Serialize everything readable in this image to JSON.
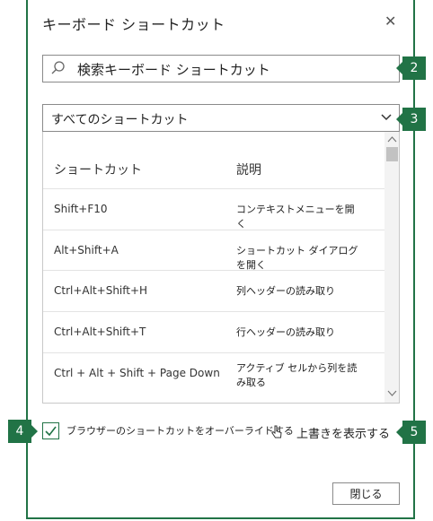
{
  "dialog": {
    "title": "キーボード ショートカット",
    "close_glyph": "✕"
  },
  "search": {
    "placeholder": "検索キーボード ショートカット"
  },
  "filter": {
    "selected": "すべてのショートカット"
  },
  "table": {
    "headers": {
      "shortcut": "ショートカット",
      "description": "説明"
    },
    "rows": [
      {
        "keys": "Shift+F10",
        "description": "コンテキストメニューを開く"
      },
      {
        "keys": "Alt+Shift+A",
        "description": "ショートカット ダイアログを開く"
      },
      {
        "keys": "Ctrl+Alt+Shift+H",
        "description": "列ヘッダーの読み取り"
      },
      {
        "keys": "Ctrl+Alt+Shift+T",
        "description": "行ヘッダーの読み取り"
      },
      {
        "keys": "Ctrl + Alt + Shift + Page Down",
        "description": "アクティブ セルから列を読み取る"
      }
    ]
  },
  "override": {
    "label": "ブラウザーのショートカットをオーバーライドする",
    "checked": true,
    "overwrite_label": "上書きを表示する"
  },
  "footer": {
    "close_label": "閉じる"
  },
  "callouts": [
    "2",
    "3",
    "4",
    "5"
  ],
  "colors": {
    "accent": "#217346",
    "border": "#8a8a8a"
  }
}
